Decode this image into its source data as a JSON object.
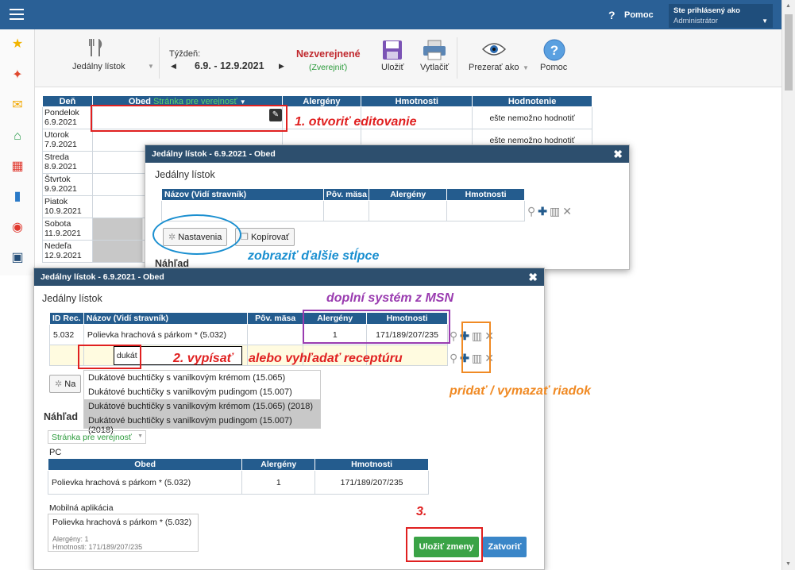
{
  "topbar": {
    "help_label": "Pomoc",
    "user_line1": "Ste prihlásený ako",
    "user_line2": "Administrátor"
  },
  "toolbar": {
    "menu_label": "Jedálny lístok",
    "week_label": "Týždeň:",
    "week_range": "6.9. - 12.9.2021",
    "status": "Nezverejnené",
    "publish": "(Zverejniť)",
    "save": "Uložiť",
    "print": "Vytlačiť",
    "view_as": "Prezerať ako",
    "help": "Pomoc"
  },
  "main_table": {
    "headers": [
      "Deň",
      "Obed",
      "Alergény",
      "Hmotnosti",
      "Hodnotenie"
    ],
    "obed_filter": "Stránka pre verejnosť",
    "rows": [
      {
        "day": "Pondelok",
        "date": "6.9.2021",
        "rating": "ešte nemožno hodnotiť"
      },
      {
        "day": "Utorok",
        "date": "7.9.2021",
        "rating": "ešte nemožno hodnotiť"
      },
      {
        "day": "Streda",
        "date": "8.9.2021",
        "rating": ""
      },
      {
        "day": "Štvrtok",
        "date": "9.9.2021",
        "rating": ""
      },
      {
        "day": "Piatok",
        "date": "10.9.2021",
        "rating": ""
      },
      {
        "day": "Sobota",
        "date": "11.9.2021",
        "rating": ""
      },
      {
        "day": "Nedeľa",
        "date": "12.9.2021",
        "rating": ""
      }
    ]
  },
  "dialog1": {
    "title": "Jedálny lístok - 6.9.2021 - Obed",
    "section": "Jedálny lístok",
    "headers": [
      "Názov (Vidí stravník)",
      "Pôv. mäsa",
      "Alergény",
      "Hmotnosti"
    ],
    "settings_btn": "Nastavenia",
    "copy_btn": "Kopírovať",
    "preview": "Náhľad"
  },
  "dialog2": {
    "title": "Jedálny lístok - 6.9.2021 - Obed",
    "section": "Jedálny lístok",
    "headers": [
      "ID Rec.",
      "Názov (Vidí stravník)",
      "Pôv. mäsa",
      "Alergény",
      "Hmotnosti"
    ],
    "row": {
      "id": "5.032",
      "name": "Polievka hrachová s párkom * (5.032)",
      "alergeny": "1",
      "hmotnosti": "171/189/207/235"
    },
    "input_value": "dukát",
    "btn_partial": "Na",
    "suggestions": [
      "Dukátové buchtičky s vanilkovým krémom (15.065)",
      "Dukátové buchtičky s vanilkovým pudingom (15.007)",
      "Dukátové buchtičky s vanilkovým krémom (15.065) (2018)",
      "Dukátové buchtičky s vanilkovým pudingom (15.007) (2018)"
    ],
    "preview": "Náhľad",
    "page_select": "Stránka pre verejnosť",
    "pc": "PC",
    "pc_headers": [
      "Obed",
      "Alergény",
      "Hmotnosti"
    ],
    "pc_row": {
      "obed": "Polievka hrachová s párkom * (5.032)",
      "alergeny": "1",
      "hmotnosti": "171/189/207/235"
    },
    "mobile_label": "Mobilná aplikácia",
    "mobile_name": "Polievka hrachová s párkom * (5.032)",
    "mobile_alergeny": "Alergény: 1",
    "mobile_hmotnosti": "Hmotnosti: 171/189/207/235",
    "save_btn": "Uložiť zmeny",
    "close_btn": "Zatvoriť"
  },
  "annotations": {
    "a1": "1. otvoriť editovanie",
    "a_blue": "zobraziť ďalšie stĺpce",
    "a_purple": "doplní systém z MSN",
    "a2": "2. vypísať",
    "a2b": "alebo vyhľadať receptúru",
    "a_orange": "pridať / vymazať riadok",
    "a3": "3."
  },
  "colors": {
    "header": "#2a6096",
    "table_header": "#245c8e",
    "dialog_header": "#2d4f6e",
    "save_green": "#3aa346",
    "close_blue": "#3a86c8"
  }
}
